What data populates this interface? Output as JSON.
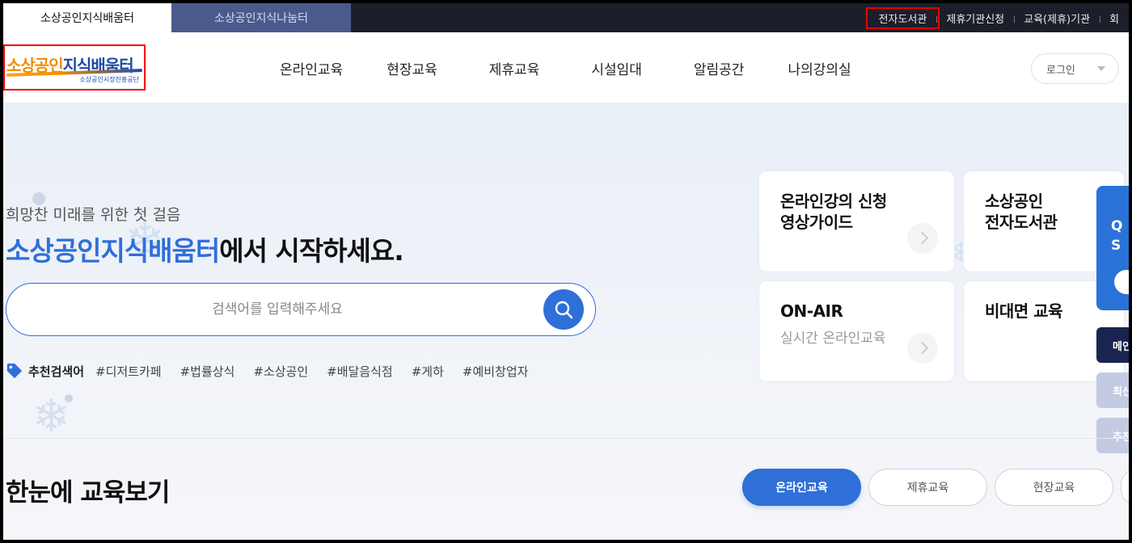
{
  "top_tabs": {
    "active": "소상공인지식배움터",
    "inactive": "소상공인지식나눔터"
  },
  "utility_links": [
    "전자도서관",
    "제휴기관신청",
    "교육(제휴)기관",
    "회"
  ],
  "logo": {
    "main_orange": "소상공인",
    "main_blue": "지식배움터",
    "sub": "소상공인시장진흥공단"
  },
  "gnb": [
    "온라인교육",
    "현장교육",
    "제휴교육",
    "시설임대",
    "알림공간",
    "나의강의실"
  ],
  "login": {
    "label": "로그인"
  },
  "hero": {
    "subtitle": "희망찬 미래를 위한 첫 걸음",
    "headline_accent": "소상공인지식배움터",
    "headline_rest": "에서 시작하세요."
  },
  "search": {
    "placeholder": "검색어를 입력해주세요"
  },
  "recommended": {
    "label": "추천검색어",
    "keywords": [
      "#디저트카페",
      "#법률상식",
      "#소상공인",
      "#배달음식점",
      "#게하",
      "#예비창업자"
    ]
  },
  "cards": [
    {
      "title": "온라인강의 신청\n영상가이드",
      "sub": ""
    },
    {
      "title": "소상공인\n전자도서관",
      "sub": ""
    },
    {
      "title": "ON-AIR",
      "sub": "실시간 온라인교육"
    },
    {
      "title": "비대면 교육",
      "sub": ""
    }
  ],
  "quick_menu": {
    "text": "Q\nS"
  },
  "side_buttons": [
    "메인",
    "최신",
    "추천"
  ],
  "section": {
    "title": "한눈에 교육보기",
    "filters": [
      "온라인교육",
      "제휴교육",
      "현장교육"
    ]
  },
  "colors": {
    "accent": "#2f6fd8",
    "topbar": "#1c1f2a",
    "tab_inactive": "#4a5a8c",
    "logo_orange": "#f08c00",
    "logo_blue": "#1c4aa8"
  }
}
